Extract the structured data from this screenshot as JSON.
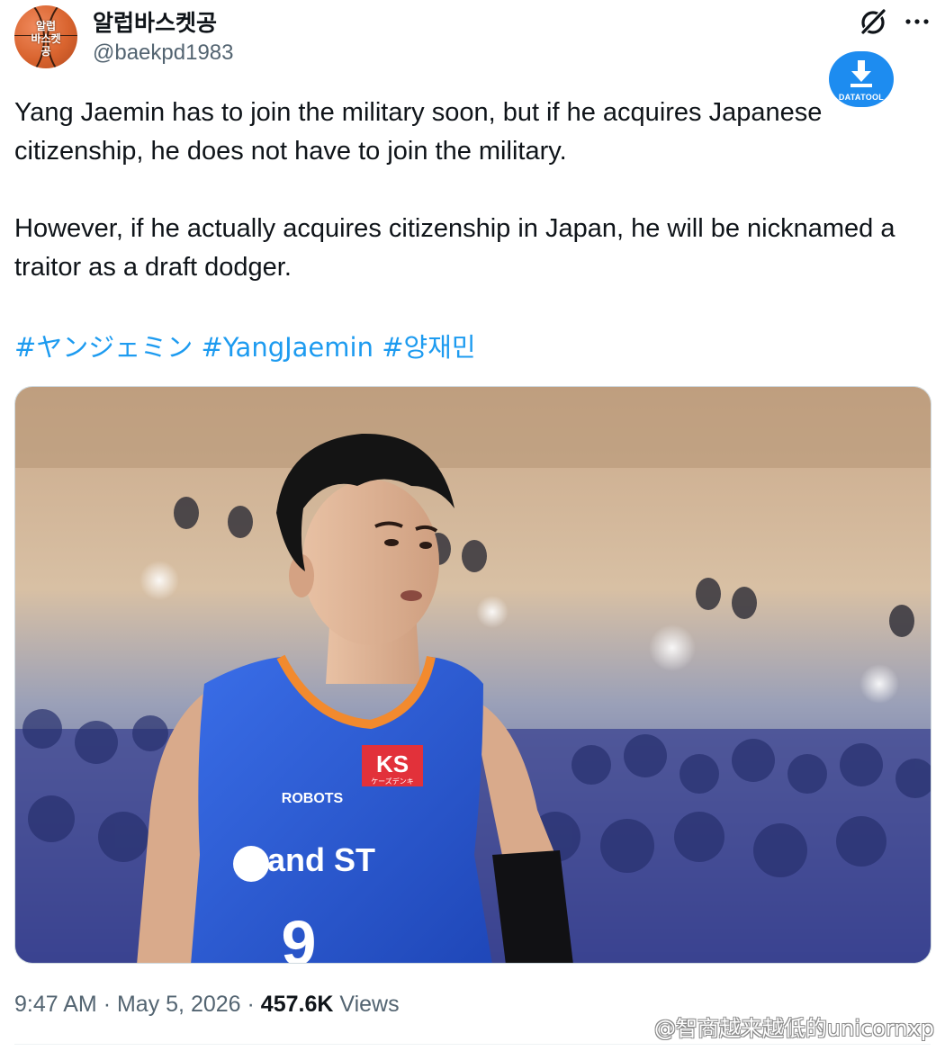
{
  "author": {
    "display_name": "알럽바스켓공",
    "handle": "@baekpd1983",
    "avatar_text": "알럽\n바스켓\n공"
  },
  "header_icons": [
    "grok-icon",
    "more-options-icon"
  ],
  "overlay": {
    "label": "DATATOOL",
    "icon": "download-icon",
    "color": "#1d8cf0"
  },
  "tweet": {
    "paragraphs": [
      "Yang Jaemin has to join the military soon, but if he acquires Japanese citizenship, he does not have to join the military.",
      "However, if he actually acquires citizenship in Japan, he will be nicknamed a traitor as a draft dodger."
    ],
    "hashtags": [
      "#ヤンジェミン",
      "#YangJaemin",
      "#양재민"
    ]
  },
  "media": {
    "description_icon": "photo",
    "jersey": {
      "team": "ROBOTS",
      "sponsor": "and ST",
      "patch": "KS",
      "patch_sub": "ケーズデンキ",
      "number": "9"
    }
  },
  "meta": {
    "time": "9:47 AM",
    "separator": "·",
    "date": "May 5, 2026",
    "views_count": "457.6K",
    "views_label": "Views"
  },
  "watermark": "@智商越来越低的unicornxp",
  "colors": {
    "link": "#1d9bf0",
    "text": "#0f1419",
    "secondary": "#536471",
    "jersey": "#2a5bd7",
    "jersey_trim": "#f28a2e"
  }
}
